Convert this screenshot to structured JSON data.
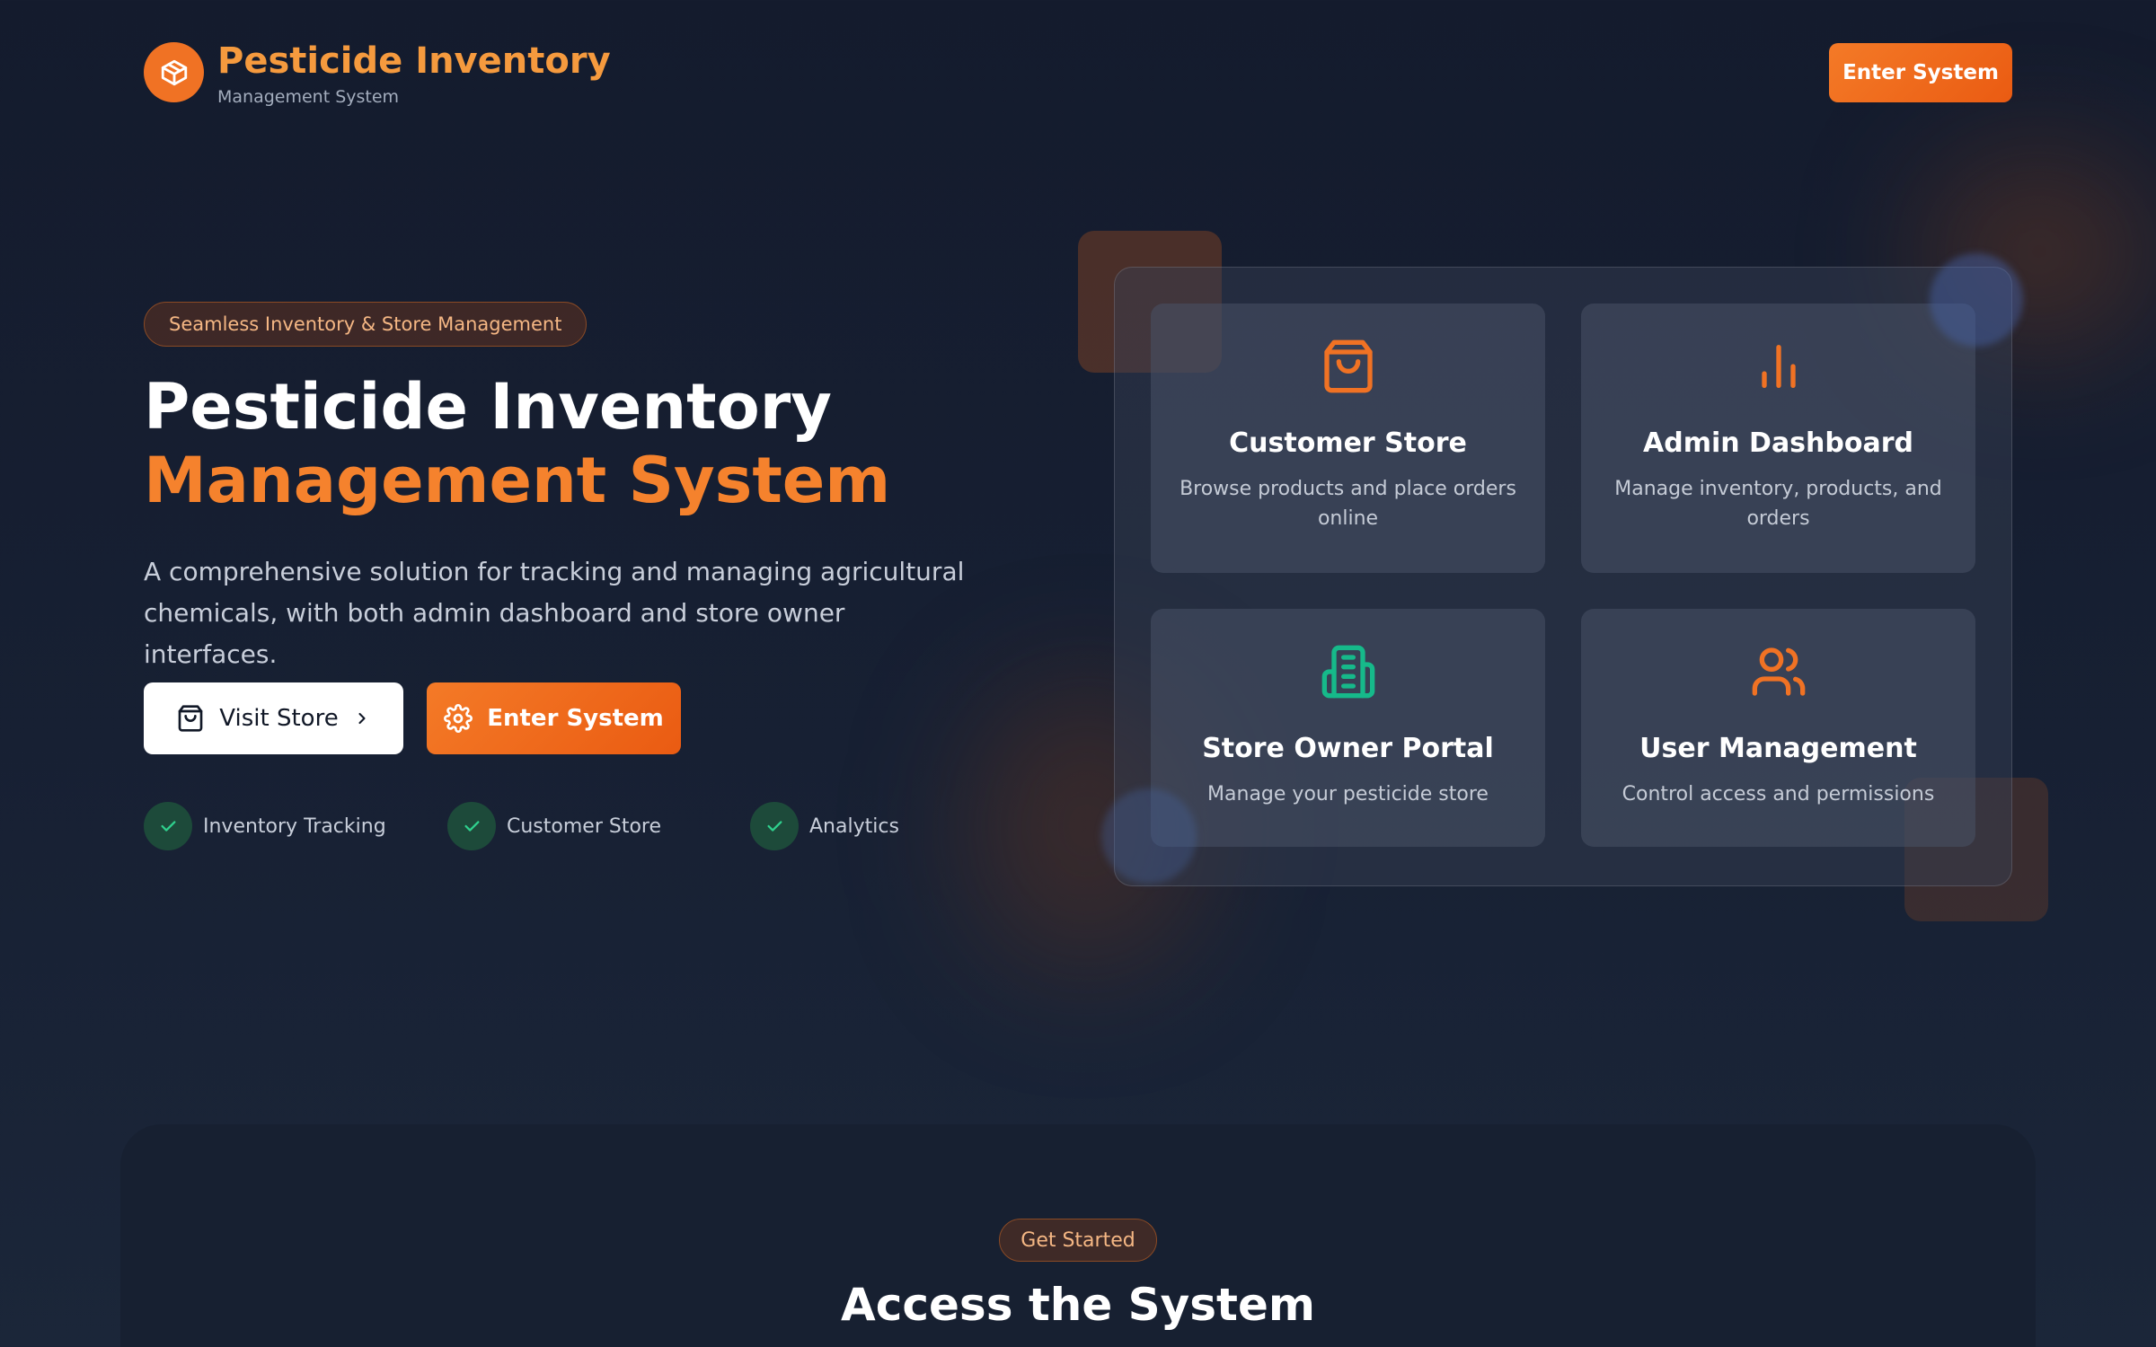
{
  "header": {
    "logo_icon": "package-icon",
    "title": "Pesticide Inventory",
    "subtitle": "Management System",
    "cta_label": "Enter System"
  },
  "hero": {
    "badge": "Seamless Inventory & Store Management",
    "title_line1": "Pesticide Inventory",
    "title_line2": "Management System",
    "description": "A comprehensive solution for tracking and managing agricultural chemicals, with both admin dashboard and store owner interfaces.",
    "visit_store_label": "Visit Store",
    "enter_system_label": "Enter System",
    "features": [
      {
        "label": "Inventory Tracking",
        "icon": "check-icon"
      },
      {
        "label": "Customer Store",
        "icon": "check-icon"
      },
      {
        "label": "Analytics",
        "icon": "check-icon"
      }
    ]
  },
  "cards": [
    {
      "icon": "shopping-bag-icon",
      "title": "Customer Store",
      "description": "Browse products and place orders online",
      "color": "#f07224"
    },
    {
      "icon": "bar-chart-icon",
      "title": "Admin Dashboard",
      "description": "Manage inventory, products, and orders",
      "color": "#f07224"
    },
    {
      "icon": "building-icon",
      "title": "Store Owner Portal",
      "description": "Manage your pesticide store",
      "color": "#16b98a"
    },
    {
      "icon": "users-icon",
      "title": "User Management",
      "description": "Control access and permissions",
      "color": "#f07224"
    }
  ],
  "access": {
    "badge": "Get Started",
    "title": "Access the System"
  },
  "colors": {
    "accent": "#f07224",
    "accent_light": "#f59a3e",
    "success": "#16b98a",
    "background": "#141b2d"
  }
}
